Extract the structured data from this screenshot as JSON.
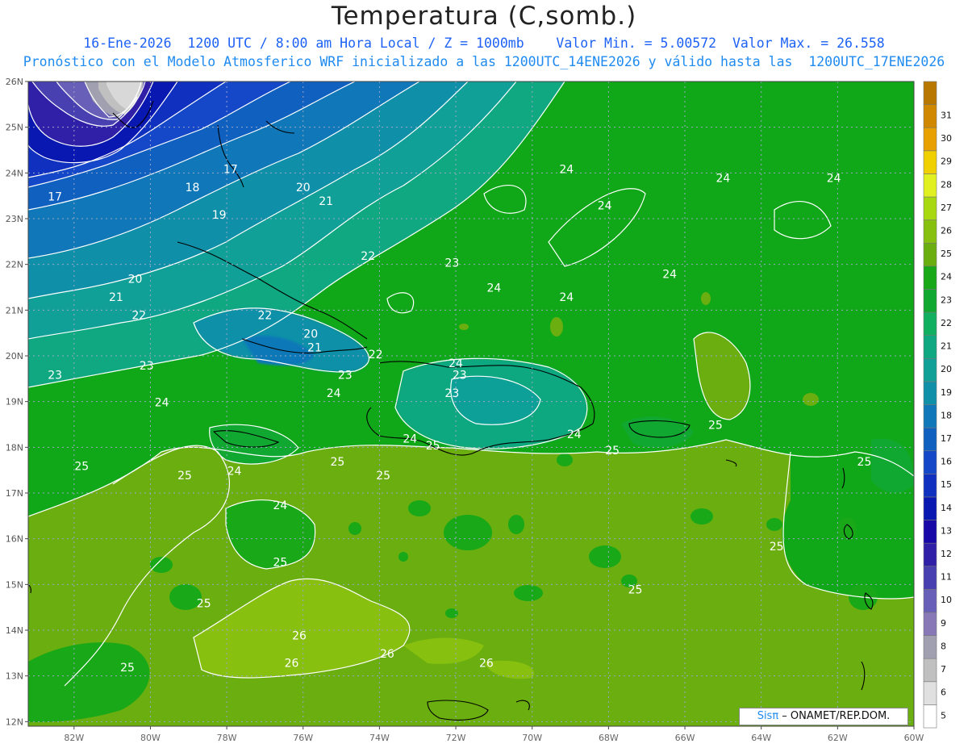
{
  "title": "Temperatura (C,somb.)",
  "subtitle_line1": "16-Ene-2026  1200 UTC / 8:00 am Hora Local / Z = 1000mb    Valor Min. = 5.00572  Valor Max. = 26.558",
  "subtitle_line2": "Pronóstico con el Modelo Atmosferico WRF inicializado a las 1200UTC_14ENE2026 y válido hasta las  1200UTC_17ENE2026",
  "credit": {
    "brand": "Sisπ",
    "rest": " – ONAMET/REP.DOM."
  },
  "axes": {
    "lat_labels": [
      "26N",
      "25N",
      "24N",
      "23N",
      "22N",
      "21N",
      "20N",
      "19N",
      "18N",
      "17N",
      "16N",
      "15N",
      "14N",
      "13N",
      "12N"
    ],
    "lat_values": [
      26,
      25,
      24,
      23,
      22,
      21,
      20,
      19,
      18,
      17,
      16,
      15,
      14,
      13,
      12
    ],
    "lon_labels": [
      "82W",
      "80W",
      "78W",
      "76W",
      "74W",
      "72W",
      "70W",
      "68W",
      "66W",
      "64W",
      "62W",
      "60W"
    ],
    "lon_values": [
      -82,
      -80,
      -78,
      -76,
      -74,
      -72,
      -70,
      -68,
      -66,
      -64,
      -62,
      -60
    ],
    "lon_range": [
      -83.2,
      -60
    ],
    "lat_range": [
      11.9,
      26
    ]
  },
  "colorbar": {
    "levels": [
      5,
      6,
      7,
      8,
      9,
      10,
      11,
      12,
      13,
      14,
      15,
      16,
      17,
      18,
      19,
      20,
      21,
      22,
      23,
      24,
      25,
      26,
      27,
      28,
      29,
      30,
      31
    ],
    "colors": [
      "#ffffff",
      "#e0e0e0",
      "#c0c0c0",
      "#a0a0b0",
      "#8878b8",
      "#6860b8",
      "#4840b0",
      "#3020a8",
      "#1808a8",
      "#0818b0",
      "#1030c0",
      "#1448c8",
      "#1060c0",
      "#1078b8",
      "#1090a8",
      "#10a098",
      "#10a880",
      "#10b060",
      "#10a830",
      "#18a818",
      "#6aae10",
      "#88c010",
      "#a8d810",
      "#e0f020",
      "#f0d000",
      "#e8a000",
      "#d08800",
      "#b87800"
    ]
  },
  "contour_labels": [
    {
      "text": "17",
      "lon": -82.5,
      "lat": 23.4
    },
    {
      "text": "17",
      "lon": -77.9,
      "lat": 24.0
    },
    {
      "text": "18",
      "lon": -78.9,
      "lat": 23.6
    },
    {
      "text": "19",
      "lon": -78.2,
      "lat": 23.0
    },
    {
      "text": "20",
      "lon": -76.0,
      "lat": 23.6
    },
    {
      "text": "21",
      "lon": -75.4,
      "lat": 23.3
    },
    {
      "text": "22",
      "lon": -74.3,
      "lat": 22.1
    },
    {
      "text": "23",
      "lon": -72.1,
      "lat": 21.95
    },
    {
      "text": "24",
      "lon": -69.1,
      "lat": 24.0
    },
    {
      "text": "24",
      "lon": -68.1,
      "lat": 23.2
    },
    {
      "text": "24",
      "lon": -65.0,
      "lat": 23.8
    },
    {
      "text": "24",
      "lon": -62.1,
      "lat": 23.8
    },
    {
      "text": "24",
      "lon": -71.0,
      "lat": 21.4
    },
    {
      "text": "24",
      "lon": -69.1,
      "lat": 21.2
    },
    {
      "text": "24",
      "lon": -66.4,
      "lat": 21.7
    },
    {
      "text": "20",
      "lon": -80.4,
      "lat": 21.6
    },
    {
      "text": "21",
      "lon": -80.9,
      "lat": 21.2
    },
    {
      "text": "22",
      "lon": -80.3,
      "lat": 20.8
    },
    {
      "text": "22",
      "lon": -77.0,
      "lat": 20.8
    },
    {
      "text": "20",
      "lon": -75.8,
      "lat": 20.4
    },
    {
      "text": "21",
      "lon": -75.7,
      "lat": 20.1
    },
    {
      "text": "22",
      "lon": -74.1,
      "lat": 19.95
    },
    {
      "text": "23",
      "lon": -82.5,
      "lat": 19.5
    },
    {
      "text": "23",
      "lon": -80.1,
      "lat": 19.7
    },
    {
      "text": "23",
      "lon": -74.9,
      "lat": 19.5
    },
    {
      "text": "24",
      "lon": -79.7,
      "lat": 18.9
    },
    {
      "text": "24",
      "lon": -75.2,
      "lat": 19.1
    },
    {
      "text": "24",
      "lon": -73.2,
      "lat": 18.1
    },
    {
      "text": "24",
      "lon": -72.0,
      "lat": 19.75
    },
    {
      "text": "23",
      "lon": -71.9,
      "lat": 19.5
    },
    {
      "text": "23",
      "lon": -72.1,
      "lat": 19.1
    },
    {
      "text": "24",
      "lon": -68.9,
      "lat": 18.2
    },
    {
      "text": "25",
      "lon": -72.6,
      "lat": 17.95
    },
    {
      "text": "25",
      "lon": -67.9,
      "lat": 17.85
    },
    {
      "text": "25",
      "lon": -65.2,
      "lat": 18.4
    },
    {
      "text": "25",
      "lon": -61.3,
      "lat": 17.6
    },
    {
      "text": "25",
      "lon": -81.8,
      "lat": 17.5
    },
    {
      "text": "25",
      "lon": -79.1,
      "lat": 17.3
    },
    {
      "text": "25",
      "lon": -75.1,
      "lat": 17.6
    },
    {
      "text": "25",
      "lon": -73.9,
      "lat": 17.3
    },
    {
      "text": "24",
      "lon": -77.8,
      "lat": 17.4
    },
    {
      "text": "24",
      "lon": -76.6,
      "lat": 16.65
    },
    {
      "text": "25",
      "lon": -76.6,
      "lat": 15.4
    },
    {
      "text": "25",
      "lon": -78.6,
      "lat": 14.5
    },
    {
      "text": "25",
      "lon": -67.3,
      "lat": 14.8
    },
    {
      "text": "25",
      "lon": -63.6,
      "lat": 15.75
    },
    {
      "text": "26",
      "lon": -76.1,
      "lat": 13.8
    },
    {
      "text": "26",
      "lon": -76.3,
      "lat": 13.2
    },
    {
      "text": "26",
      "lon": -73.8,
      "lat": 13.4
    },
    {
      "text": "26",
      "lon": -71.2,
      "lat": 13.2
    },
    {
      "text": "25",
      "lon": -80.6,
      "lat": 13.1
    }
  ]
}
